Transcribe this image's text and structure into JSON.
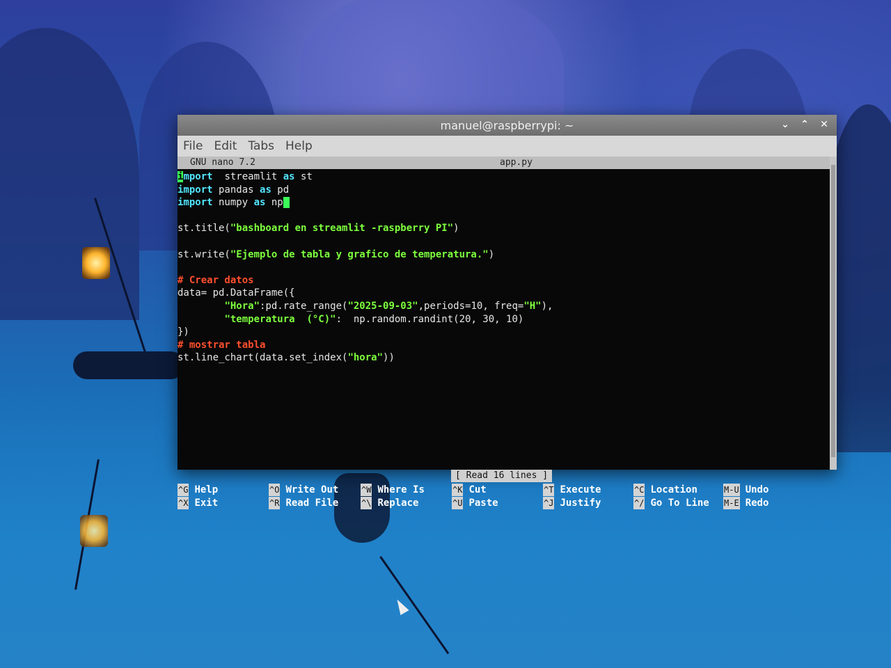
{
  "window": {
    "title": "manuel@raspberrypi: ~",
    "controls": [
      "⌄",
      "⌃",
      "✕"
    ]
  },
  "menu": [
    "File",
    "Edit",
    "Tabs",
    "Help"
  ],
  "nano": {
    "version": "GNU nano 7.2",
    "filename": "app.py",
    "status": "[ Read 16 lines ]"
  },
  "code": {
    "l1": [
      "i",
      "mport",
      "  streamlit ",
      "as",
      " st"
    ],
    "l2": [
      "import",
      " pandas ",
      "as",
      " pd"
    ],
    "l3": [
      "import",
      " numpy ",
      "as",
      " np"
    ],
    "l5a": "st.title(",
    "l5b": "\"bashboard en streamlit -raspberry PI\"",
    "l5c": ")",
    "l7a": "st.write(",
    "l7b": "\"Ejemplo de tabla y grafico de temperatura.\"",
    "l7c": ")",
    "l9": "# Crear datos",
    "l10": "data= pd.DataFrame({",
    "l11a": "        ",
    "l11b": "\"Hora\"",
    "l11c": ":pd.rate_range(",
    "l11d": "\"2025-09-03\"",
    "l11e": ",periods=10, freq=",
    "l11f": "\"H\"",
    "l11g": "),",
    "l12a": "        ",
    "l12b": "\"temperatura  (°C)\"",
    "l12c": ":  np.random.randint(20, 30, 10)",
    "l13": "})",
    "l14": "# mostrar tabla",
    "l15a": "st.line_chart(data.set_index(",
    "l15b": "\"hora\"",
    "l15c": "))"
  },
  "shortcuts": [
    {
      "key": "^G",
      "label": "Help"
    },
    {
      "key": "^X",
      "label": "Exit"
    },
    {
      "key": "^O",
      "label": "Write Out"
    },
    {
      "key": "^R",
      "label": "Read File"
    },
    {
      "key": "^W",
      "label": "Where Is"
    },
    {
      "key": "^\\",
      "label": "Replace"
    },
    {
      "key": "^K",
      "label": "Cut"
    },
    {
      "key": "^U",
      "label": "Paste"
    },
    {
      "key": "^T",
      "label": "Execute"
    },
    {
      "key": "^J",
      "label": "Justify"
    },
    {
      "key": "^C",
      "label": "Location"
    },
    {
      "key": "^/",
      "label": "Go To Line"
    },
    {
      "key": "M-U",
      "label": "Undo"
    },
    {
      "key": "M-E",
      "label": "Redo"
    }
  ]
}
